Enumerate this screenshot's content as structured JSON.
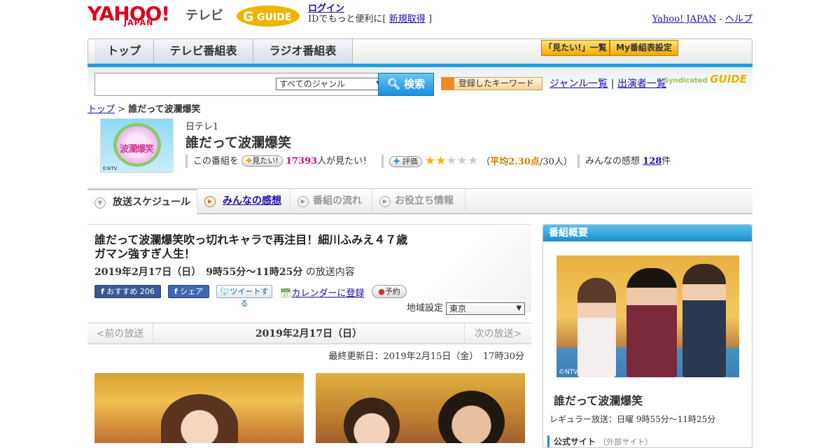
{
  "header": {
    "yahoo_logo": "YAHOO!",
    "yahoo_sub": "JAPAN",
    "tv_label": "テレビ",
    "gguide_logo": "G GUIDE",
    "login_label": "ログイン",
    "id_prompt": "IDでもっと便利に[",
    "register_label": "新規取得",
    "bracket_close": "]",
    "yahoo_japan_link": "Yahoo! JAPAN",
    "separator": "-",
    "help_link": "ヘルプ"
  },
  "nav": {
    "tabs": [
      "トップ",
      "テレビ番組表",
      "ラジオ番組表"
    ],
    "mitai_list": "「見たい!」一覧",
    "my_schedule": "My番組表設定"
  },
  "search": {
    "genre_selected": "すべてのジャンル",
    "search_button": "検索",
    "keyword_button": "登録したキーワード",
    "genre_list": "ジャンル一覧",
    "sep": "|",
    "performer_list": "出演者一覧",
    "syndicated": "Syndicated",
    "guide": "GUIDE"
  },
  "breadcrumb": {
    "top": "トップ",
    "sep": ">",
    "current": "誰だって波瀾爆笑"
  },
  "program": {
    "thumb_text": "波瀾爆笑",
    "thumb_credit": "©NTV",
    "channel": "日テレ1",
    "title": "誰だって波瀾爆笑",
    "watch_prefix": "この番組を",
    "mitai_button": "見たい!",
    "watch_count": "17393",
    "watch_suffix": "人が見たい！",
    "rate_button": "評価",
    "rating_value": 2.3,
    "rating_open": "（",
    "rating_avg": "平均2.30点",
    "rating_count": "/30人）",
    "reviews_label": "みんなの感想",
    "reviews_count": "128",
    "reviews_unit": "件"
  },
  "tabs": {
    "schedule": "放送スケジュール",
    "reviews": "みんなの感想",
    "flow": "番組の流れ",
    "info": "お役立ち情報"
  },
  "article": {
    "title_line1": "誰だって波瀾爆笑吹っ切れキャラで再注目！細川ふみえ４７歳",
    "title_line2": "ガマン強すぎ人生！",
    "date": "2019年2月17日（日）　9時55分～11時25分",
    "date_suffix": "の放送内容",
    "fb_recommend": "おすすめ 206",
    "fb_share": "シェア",
    "tweet": "ツイートする",
    "calendar": "カレンダーに登録",
    "reserve": "予約",
    "region_label": "地域設定",
    "region_value": "東京",
    "prev": "<前の放送",
    "current_date": "2019年2月17日（日）",
    "next": "次の放送>",
    "updated": "最終更新日：2019年2月15日（金）　17時30分"
  },
  "sidebar": {
    "header": "番組概要",
    "photo_credit": "©NTV",
    "title": "誰だって波瀾爆笑",
    "regular": "レギュラー放送：日曜 9時55分～11時25分",
    "official_site": "公式サイト",
    "external": "（外部サイト）"
  }
}
